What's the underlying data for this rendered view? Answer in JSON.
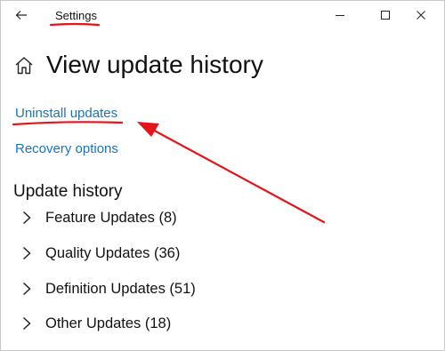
{
  "window": {
    "title": "Settings"
  },
  "icons": {
    "back": "arrow-left-icon",
    "minimize": "minimize-icon",
    "maximize": "maximize-icon",
    "close": "close-icon",
    "home": "home-icon",
    "chevron": "chevron-right-icon"
  },
  "page": {
    "title": "View update history"
  },
  "links": {
    "uninstall": "Uninstall updates",
    "recovery": "Recovery options"
  },
  "history": {
    "heading": "Update history",
    "items": [
      {
        "label": "Feature Updates (8)"
      },
      {
        "label": "Quality Updates (36)"
      },
      {
        "label": "Definition Updates (51)"
      },
      {
        "label": "Other Updates (18)"
      }
    ]
  },
  "colors": {
    "link": "#1876b8",
    "annotation": "#e3151a"
  }
}
